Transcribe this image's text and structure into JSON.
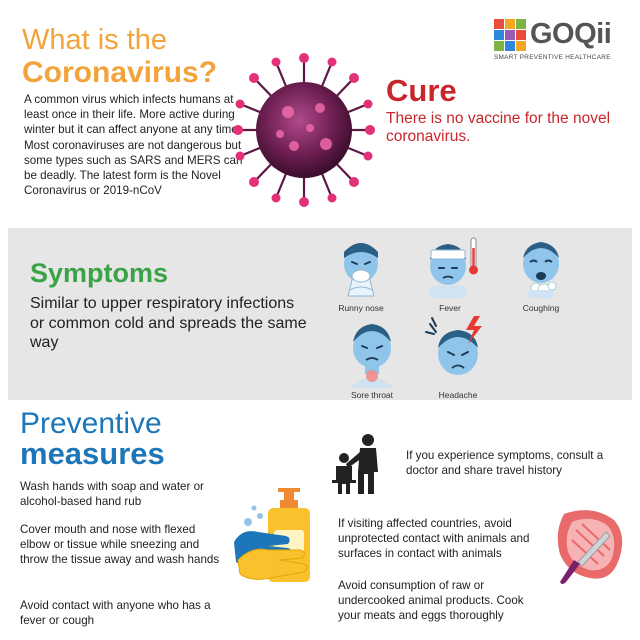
{
  "header": {
    "title_line1": "What is the",
    "title_line2": "Coronavirus?",
    "intro": "A common virus which infects humans at least once in their life. More active during winter but it can affect anyone at any time.  Most coronaviruses are not dangerous but some types such as SARS and MERS can be deadly. The latest form is the Novel Coronavirus or 2019-nCoV"
  },
  "logo": {
    "word": "GOQii",
    "tagline": "SMART PREVENTIVE HEALTHCARE"
  },
  "cure": {
    "title": "Cure",
    "text": "There is no vaccine for the novel coronavirus."
  },
  "symptoms": {
    "title": "Symptoms",
    "text": "Similar to upper respiratory infections or common cold and spreads the same way",
    "items": [
      {
        "label": "Runny nose",
        "icon": "runny-nose-face-icon"
      },
      {
        "label": "Fever",
        "icon": "fever-face-icon"
      },
      {
        "label": "Coughing",
        "icon": "coughing-face-icon"
      },
      {
        "label": "Sore throat",
        "icon": "sore-throat-face-icon"
      },
      {
        "label": "Headache",
        "icon": "headache-face-icon"
      }
    ]
  },
  "preventive": {
    "title_line1": "Preventive",
    "title_line2": "measures",
    "left_items": [
      "Wash hands with soap and water or alcohol-based hand rub",
      "Cover mouth and nose with flexed elbow or tissue while sneezing and throw the tissue away and wash hands",
      "Avoid contact with anyone who has a fever or cough"
    ],
    "right_items": [
      "If you experience symptoms, consult a doctor and share travel history",
      "If visiting affected countries, avoid unprotected contact with animals and surfaces in contact with animals",
      "Avoid consumption of raw or undercooked animal products. Cook your meats and eggs thoroughly"
    ]
  },
  "colors": {
    "orange": "#f2a33a",
    "red": "#c8262b",
    "green": "#3aa346",
    "blue": "#1c76b9",
    "band": "#e6e6e6"
  }
}
